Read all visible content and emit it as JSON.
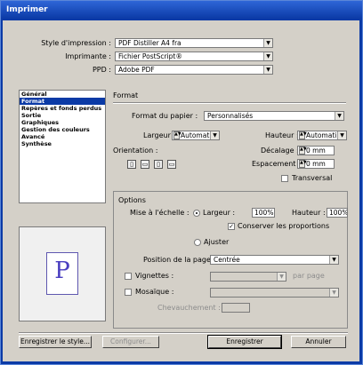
{
  "window": {
    "title": "Imprimer"
  },
  "top": {
    "style_label": "Style d'impression :",
    "style_value": "PDF Distiller A4 fra",
    "printer_label": "Imprimante :",
    "printer_value": "Fichier PostScript®",
    "ppd_label": "PPD :",
    "ppd_value": "Adobe PDF"
  },
  "sidebar": {
    "items": [
      {
        "label": "Général"
      },
      {
        "label": "Format"
      },
      {
        "label": "Repères et fonds perdus"
      },
      {
        "label": "Sortie"
      },
      {
        "label": "Graphiques"
      },
      {
        "label": "Gestion des couleurs"
      },
      {
        "label": "Avancé"
      },
      {
        "label": "Synthèse"
      }
    ],
    "selected": "Format"
  },
  "format": {
    "section_title": "Format",
    "paper_label": "Format du papier :",
    "paper_value": "Personnalisés",
    "width_label": "Largeur :",
    "width_value": "Automati",
    "height_label": "Hauteur :",
    "height_value": "Automati",
    "orientation_label": "Orientation :",
    "offset_label": "Décalage :",
    "offset_value": "0 mm",
    "spacing_label": "Espacement :",
    "spacing_value": "0 mm",
    "transverse_label": "Transversal",
    "transverse_checked": false
  },
  "options": {
    "title": "Options",
    "scale_label": "Mise à l'échelle :",
    "width_radio_label": "Largeur :",
    "width_scale": "100%",
    "height_scale_label": "Hauteur :",
    "height_scale": "100%",
    "keep_proportions_label": "Conserver les proportions",
    "keep_proportions_checked": true,
    "fit_label": "Ajuster",
    "page_position_label": "Position de la page :",
    "page_position_value": "Centrée",
    "thumbnails_label": "Vignettes :",
    "per_page_label": "par page",
    "mosaic_label": "Mosaïque :",
    "overlap_label": "Chevauchement :"
  },
  "preview": {
    "letter": "P"
  },
  "buttons": {
    "save_style": "Enregistrer le style...",
    "configure": "Configurer...",
    "save": "Enregistrer",
    "cancel": "Annuler"
  }
}
